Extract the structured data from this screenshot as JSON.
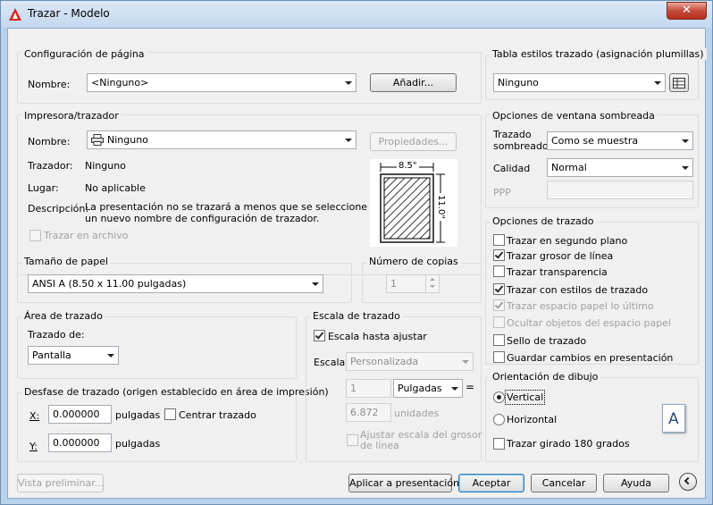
{
  "window": {
    "title": "Trazar - Modelo",
    "close": "✕"
  },
  "page_setup": {
    "group": "Configuración de página",
    "name_label": "Nombre:",
    "name_value": "<Ninguno>",
    "add_button": "Añadir..."
  },
  "printer": {
    "group": "Impresora/trazador",
    "name_label": "Nombre:",
    "name_value": "Ninguno",
    "properties_button": "Propiedades...",
    "plotter_label": "Trazador:",
    "plotter_value": "Ninguno",
    "location_label": "Lugar:",
    "location_value": "No aplicable",
    "description_label": "Descripción:",
    "description_line1": "La presentación no se trazará a menos que se seleccione",
    "description_line2": "un nuevo nombre de configuración de trazador.",
    "plot_to_file": "Trazar en archivo",
    "preview_width": "8.5\"",
    "preview_height": "11.0\""
  },
  "paper_size": {
    "group": "Tamaño de papel",
    "value": "ANSI A (8.50 x 11.00 pulgadas)"
  },
  "copies": {
    "group": "Número de copias",
    "value": "1"
  },
  "plot_area": {
    "group": "Área de trazado",
    "what_label": "Trazado de:",
    "what_value": "Pantalla"
  },
  "plot_offset": {
    "group": "Desfase de trazado (origen establecido en área de impresión)",
    "x_label": "X:",
    "x_value": "0.000000",
    "x_unit": "pulgadas",
    "y_label": "Y:",
    "y_value": "0.000000",
    "y_unit": "pulgadas",
    "center": "Centrar trazado"
  },
  "plot_scale": {
    "group": "Escala de trazado",
    "fit": "Escala hasta ajustar",
    "scale_label": "Escala:",
    "scale_value": "Personalizada",
    "value1": "1",
    "units1": "Pulgadas",
    "equals": "=",
    "value2": "6.872",
    "units2": "unidades",
    "lineweights_line1": "Ajustar escala del grosor",
    "lineweights_line2": "de línea"
  },
  "style_table": {
    "group": "Tabla estilos trazado (asignación plumillas)",
    "value": "Ninguno"
  },
  "shaded": {
    "group": "Opciones de ventana sombreada",
    "shade_label_line1": "Trazado",
    "shade_label_line2": "sombreado",
    "shade_value": "Como se muestra",
    "quality_label": "Calidad",
    "quality_value": "Normal",
    "dpi_label": "PPP"
  },
  "plot_options": {
    "group": "Opciones de trazado",
    "items": [
      {
        "label": "Trazar en segundo plano",
        "checked": false,
        "disabled": false
      },
      {
        "label": "Trazar grosor de línea",
        "checked": true,
        "disabled": false
      },
      {
        "label": "Trazar transparencia",
        "checked": false,
        "disabled": false
      },
      {
        "label": "Trazar con estilos de trazado",
        "checked": true,
        "disabled": false
      },
      {
        "label": "Trazar espacio papel lo último",
        "checked": true,
        "disabled": true
      },
      {
        "label": "Ocultar objetos del espacio papel",
        "checked": false,
        "disabled": true
      },
      {
        "label": "Sello de trazado",
        "checked": false,
        "disabled": false
      },
      {
        "label": "Guardar cambios en presentación",
        "checked": false,
        "disabled": false
      }
    ]
  },
  "orientation": {
    "group": "Orientación de dibujo",
    "portrait": "Vertical",
    "landscape": "Horizontal",
    "upside_down": "Trazar girado 180 grados",
    "icon_letter": "A"
  },
  "footer": {
    "preview": "Vista preliminar...",
    "apply": "Aplicar a presentación",
    "ok": "Aceptar",
    "cancel": "Cancelar",
    "help": "Ayuda"
  },
  "colors": {
    "accent": "#3c7fb1",
    "title_bg": "#c4d8ee",
    "close": "#c74b3b",
    "autocad_red": "#d8251e"
  }
}
